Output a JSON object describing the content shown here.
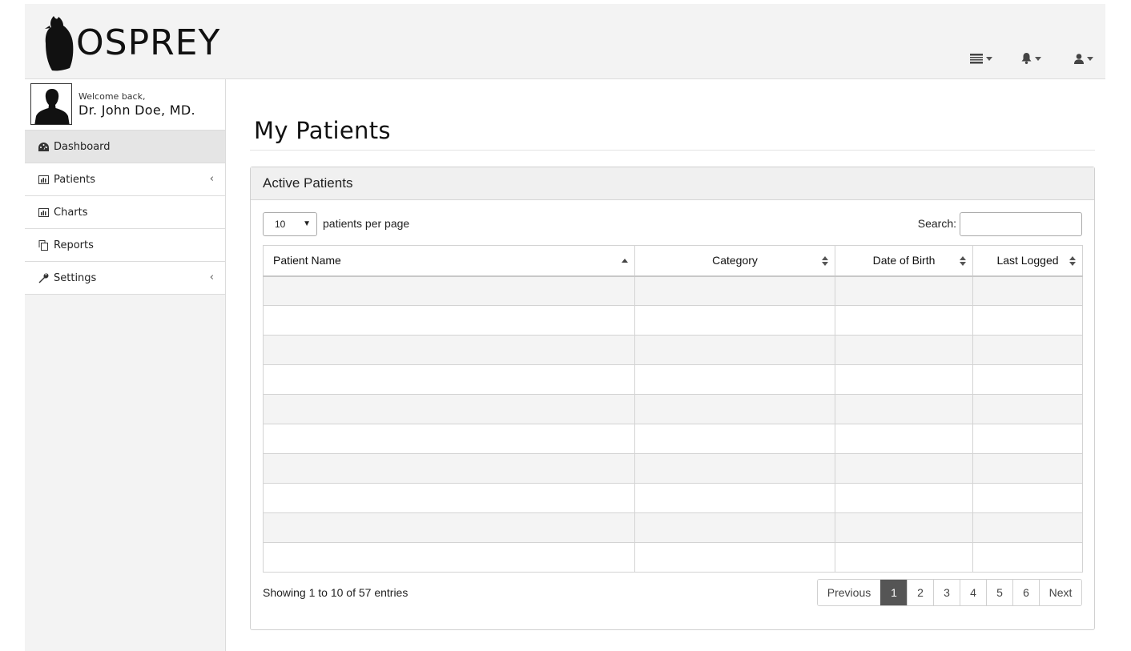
{
  "header": {
    "logo_text": "OSPREY",
    "icons": [
      "list-icon",
      "bell-icon",
      "user-icon"
    ]
  },
  "sidebar": {
    "welcome": "Welcome back,",
    "user_name": "Dr. John Doe, MD.",
    "items": [
      {
        "label": "Dashboard",
        "icon": "dashboard-icon",
        "active": true,
        "has_submenu": false
      },
      {
        "label": "Patients",
        "icon": "bar-chart-icon",
        "active": false,
        "has_submenu": true
      },
      {
        "label": "Charts",
        "icon": "bar-chart-icon",
        "active": false,
        "has_submenu": false
      },
      {
        "label": "Reports",
        "icon": "copy-icon",
        "active": false,
        "has_submenu": false
      },
      {
        "label": "Settings",
        "icon": "wrench-icon",
        "active": false,
        "has_submenu": true
      }
    ]
  },
  "main": {
    "title": "My Patients",
    "panel_title": "Active Patients",
    "per_page_value": "10",
    "per_page_label": "patients per page",
    "search_label": "Search:",
    "search_value": "",
    "columns": [
      "Patient Name",
      "Category",
      "Date of Birth",
      "Last Logged"
    ],
    "row_count": 10,
    "info": "Showing 1 to 10 of 57 entries",
    "pagination": {
      "previous": "Previous",
      "next": "Next",
      "pages": [
        "1",
        "2",
        "3",
        "4",
        "5",
        "6"
      ],
      "current": "1"
    }
  }
}
